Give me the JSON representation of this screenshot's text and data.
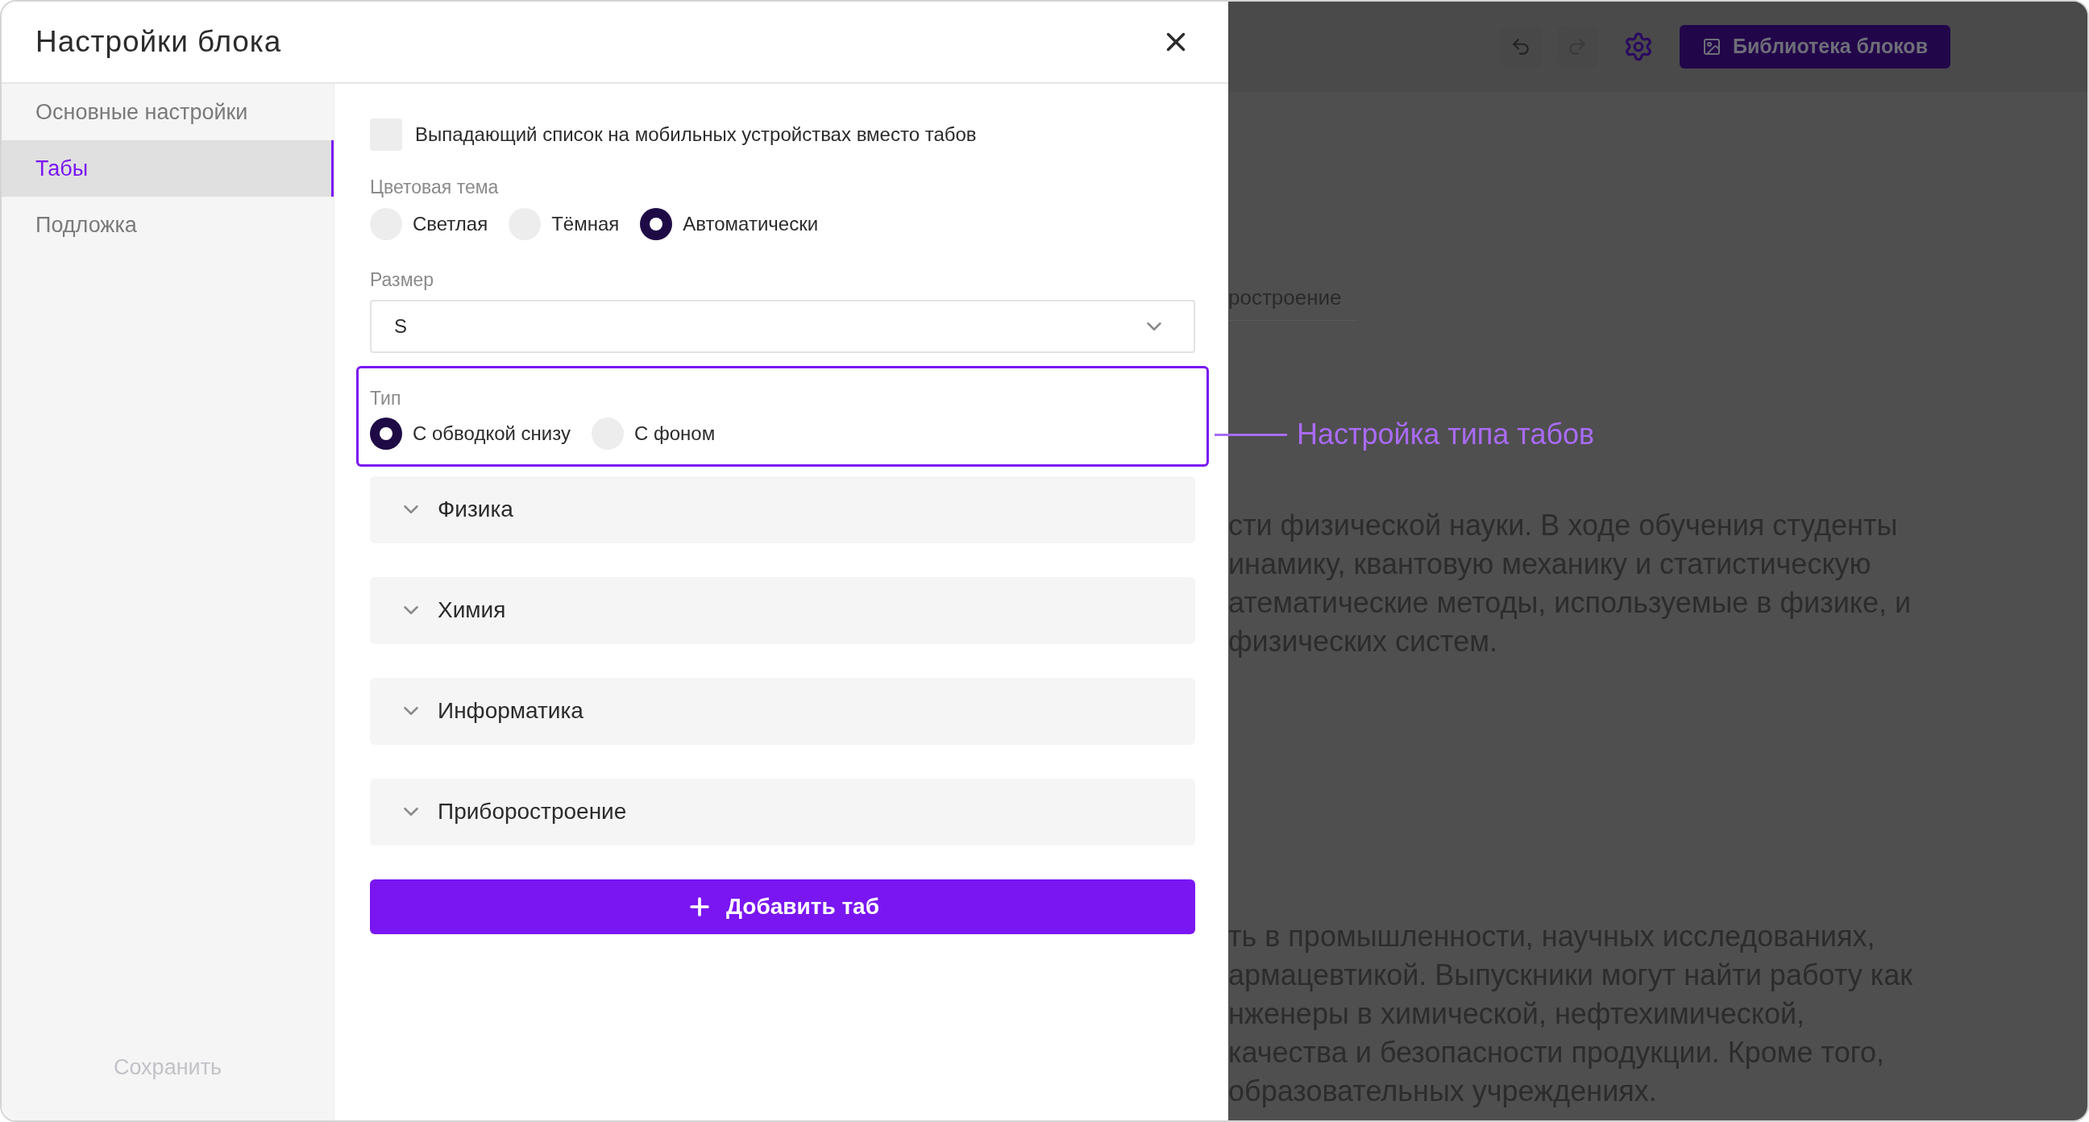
{
  "dialog": {
    "title": "Настройки блока"
  },
  "sidebar": {
    "items": [
      {
        "label": "Основные настройки",
        "selected": false
      },
      {
        "label": "Табы",
        "selected": true
      },
      {
        "label": "Подложка",
        "selected": false
      }
    ],
    "save": {
      "label": "Сохранить",
      "disabled": true
    }
  },
  "mobile_dropdown": {
    "label": "Выпадающий список на мобильных устройствах вместо табов",
    "checked": false
  },
  "color_theme": {
    "label": "Цветовая тема",
    "options": [
      {
        "label": "Светлая",
        "selected": false
      },
      {
        "label": "Тёмная",
        "selected": false
      },
      {
        "label": "Автоматически",
        "selected": true
      }
    ]
  },
  "size": {
    "label": "Размер",
    "value": "S"
  },
  "type": {
    "label": "Тип",
    "options": [
      {
        "label": "С обводкой снизу",
        "selected": true
      },
      {
        "label": "С фоном",
        "selected": false
      }
    ]
  },
  "tabs": [
    {
      "label": "Физика",
      "expanded": false
    },
    {
      "label": "Химия",
      "expanded": false
    },
    {
      "label": "Информатика",
      "expanded": false
    },
    {
      "label": "Приборостроение",
      "expanded": false
    }
  ],
  "add_button": "Добавить таб",
  "annotation": "Настройка типа табов",
  "background": {
    "library_button": "Библиотека блоков",
    "tab_label": "ростроение",
    "paragraphs": [
      [
        "сти физической науки. В ходе обучения студенты",
        "инамику, квантовую механику и статистическую",
        "атематические методы, используемые в физике, и",
        "физических систем."
      ],
      [
        "ть в промышленности, научных исследованиях,",
        "армацевтикой. Выпускники могут найти работу как",
        "нженеры в химической, нефтехимической,",
        "качества и безопасности продукции. Кроме того,",
        "образовательных учреждениях."
      ]
    ]
  }
}
